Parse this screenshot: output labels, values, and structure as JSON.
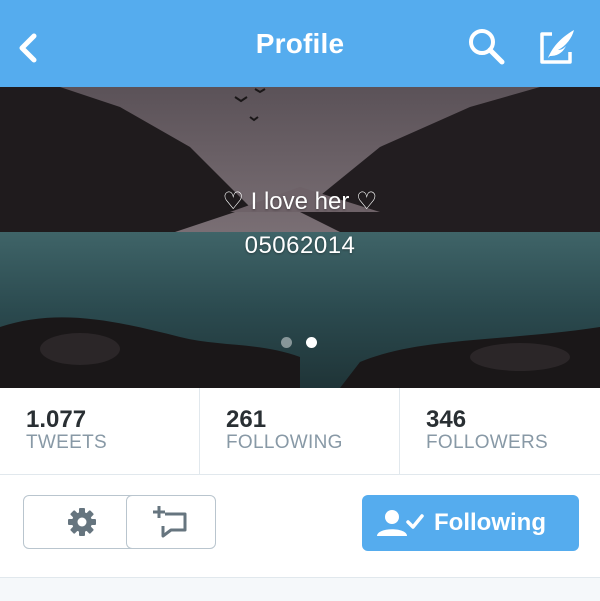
{
  "navbar": {
    "title": "Profile",
    "icons": [
      "chevron-left-icon",
      "search-icon",
      "compose-tweet-icon"
    ]
  },
  "banner": {
    "line1": "♡ I love her ♡",
    "line2": "05062014",
    "page_dots": {
      "count": 2,
      "active_index": 1
    }
  },
  "stats": [
    {
      "value": "1.077",
      "label": "TWEETS"
    },
    {
      "value": "261",
      "label": "FOLLOWING"
    },
    {
      "value": "346",
      "label": "FOLLOWERS"
    }
  ],
  "actions": {
    "settings_icon": "gear-icon",
    "lists_icon": "add-to-list-icon",
    "following_label": "Following",
    "following_icon": "user-check-icon"
  },
  "colors": {
    "brand": "#55acee",
    "text_primary": "#292f33",
    "text_secondary": "#8899a6",
    "border": "#e1e8ed"
  }
}
